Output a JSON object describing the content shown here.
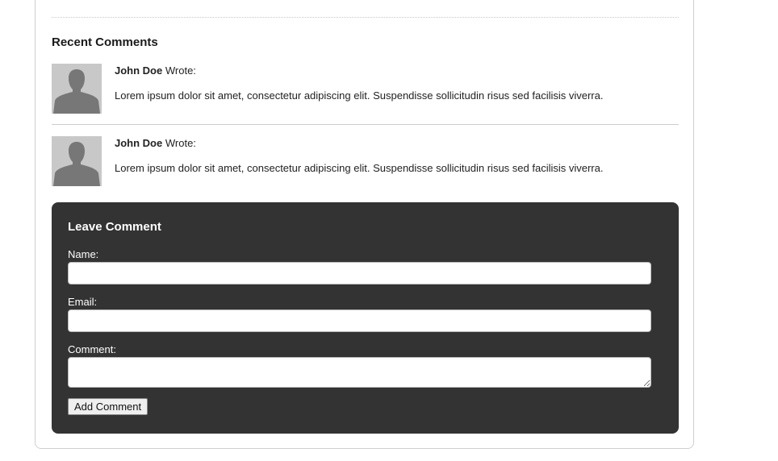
{
  "recent_comments": {
    "title": "Recent Comments",
    "items": [
      {
        "author": "John Doe",
        "verb": "Wrote:",
        "text": "Lorem ipsum dolor sit amet, consectetur adipiscing elit. Suspendisse sollicitudin risus sed facilisis viverra.",
        "avatar_icon": "user-silhouette-icon"
      },
      {
        "author": "John Doe",
        "verb": "Wrote:",
        "text": "Lorem ipsum dolor sit amet, consectetur adipiscing elit. Suspendisse sollicitudin risus sed facilisis viverra.",
        "avatar_icon": "user-silhouette-icon"
      }
    ]
  },
  "leave_comment": {
    "title": "Leave Comment",
    "name_label": "Name:",
    "name_value": "",
    "email_label": "Email:",
    "email_value": "",
    "comment_label": "Comment:",
    "comment_value": "",
    "submit_label": "Add Comment"
  },
  "colors": {
    "form_background": "#333333",
    "avatar_background": "#c8c8c8",
    "avatar_silhouette": "#777777"
  }
}
